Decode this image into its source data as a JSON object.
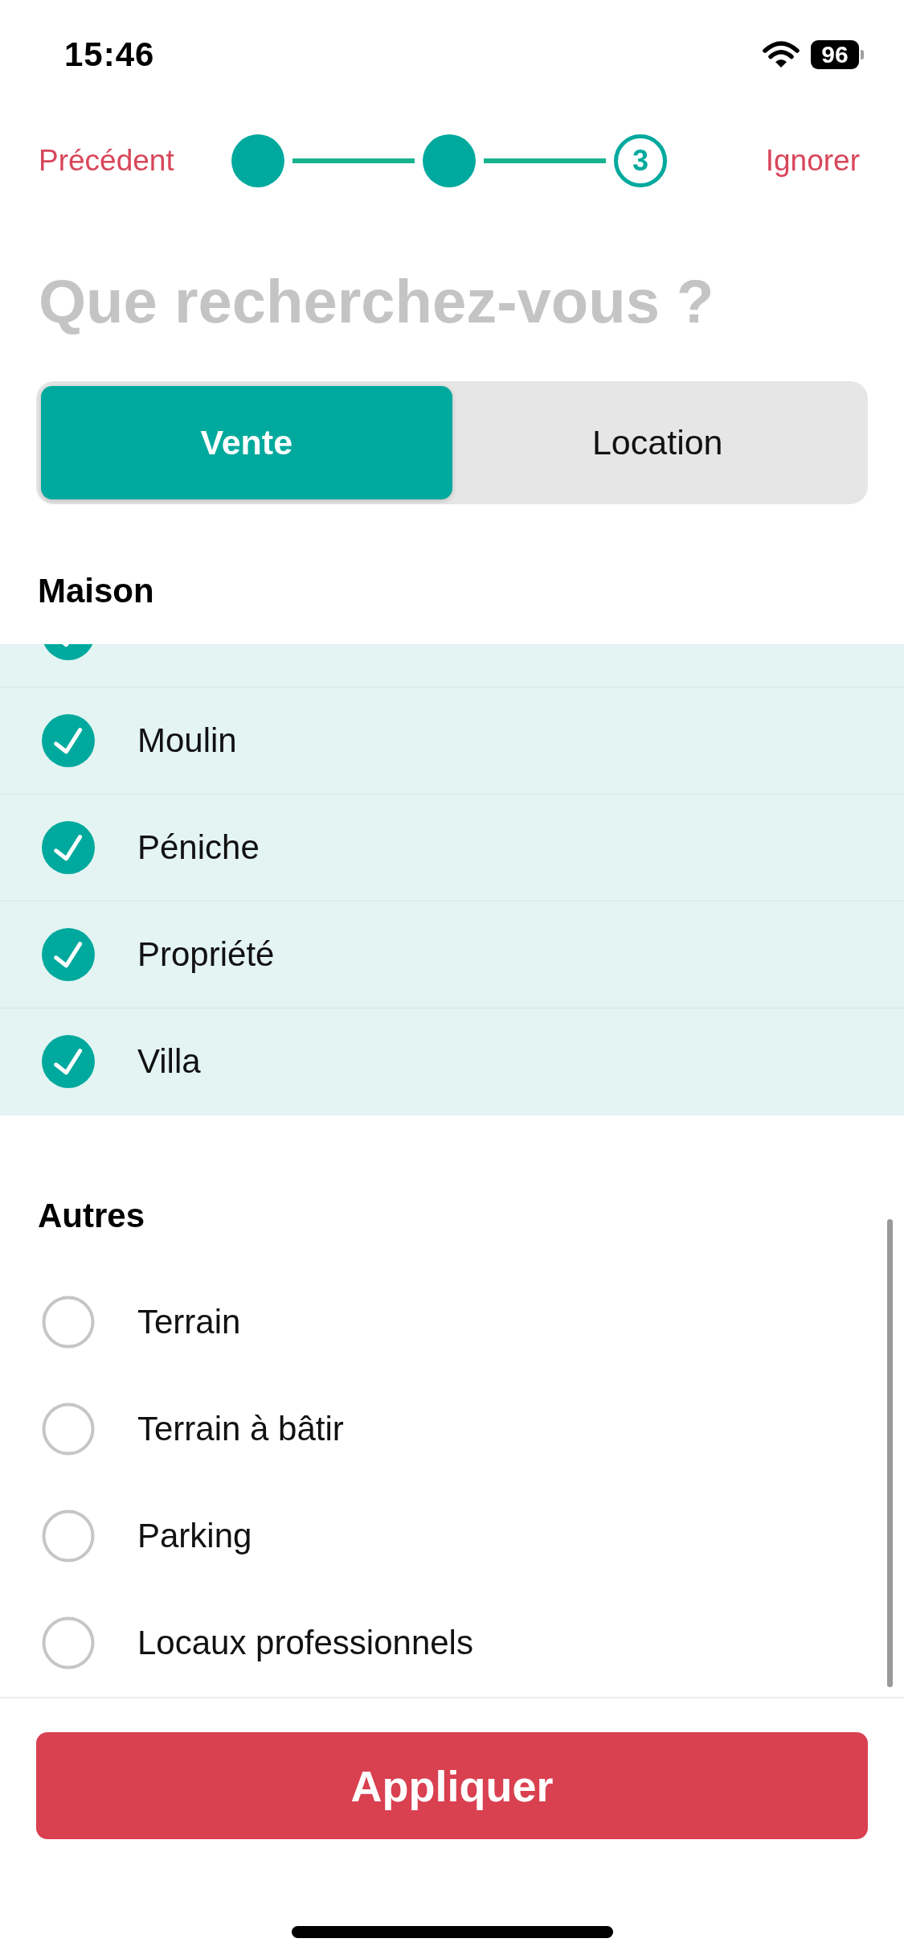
{
  "status_bar": {
    "time": "15:46",
    "battery": "96"
  },
  "nav": {
    "back": "Précédent",
    "skip": "Ignorer",
    "steps": [
      {
        "completed": true
      },
      {
        "completed": true
      },
      {
        "completed": false,
        "label": "3"
      }
    ]
  },
  "title": "Que recherchez-vous ?",
  "tabs": [
    {
      "label": "Vente",
      "selected": true
    },
    {
      "label": "Location",
      "selected": false
    }
  ],
  "sections": [
    {
      "title": "Maison",
      "items": [
        {
          "kind": "partial",
          "checked": true
        },
        {
          "kind": "full",
          "label": "Moulin",
          "checked": true
        },
        {
          "kind": "full",
          "label": "Péniche",
          "checked": true
        },
        {
          "kind": "full",
          "label": "Propriété",
          "checked": true
        },
        {
          "kind": "full",
          "label": "Villa",
          "checked": true
        }
      ]
    },
    {
      "title": "Autres",
      "items": [
        {
          "kind": "full",
          "label": "Terrain",
          "checked": false
        },
        {
          "kind": "full",
          "label": "Terrain à bâtir",
          "checked": false
        },
        {
          "kind": "full",
          "label": "Parking",
          "checked": false
        },
        {
          "kind": "full",
          "label": "Locaux professionnels",
          "checked": false
        }
      ]
    }
  ],
  "apply_button": "Appliquer"
}
